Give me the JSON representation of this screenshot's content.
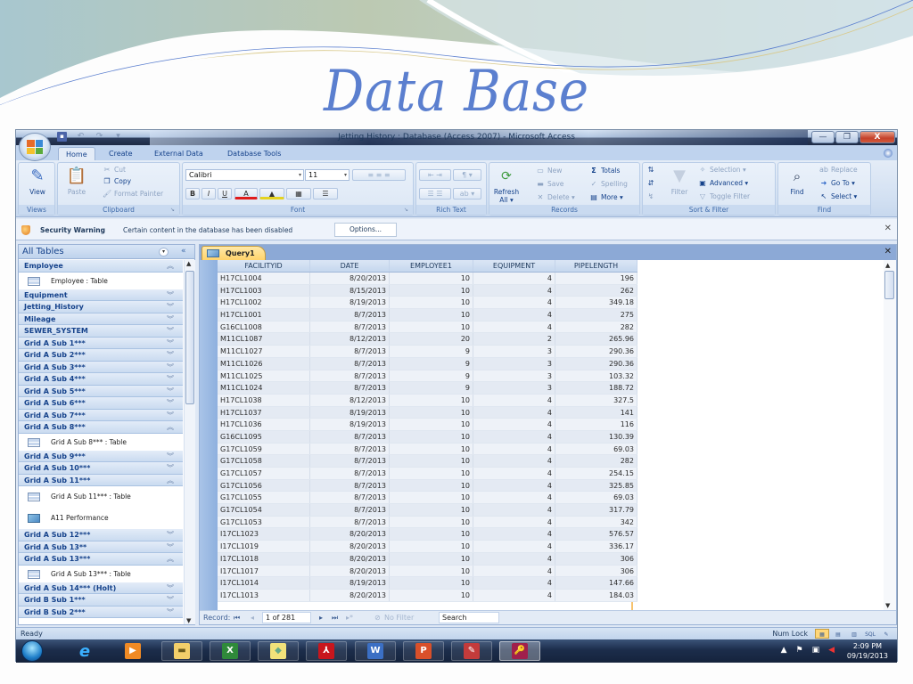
{
  "slide": {
    "title": "Data Base"
  },
  "window": {
    "title": "Jetting History : Database (Access 2007) - Microsoft Access",
    "minimize": "—",
    "maximize": "❐",
    "close": "X"
  },
  "ribbon": {
    "tabs": [
      "Home",
      "Create",
      "External Data",
      "Database Tools"
    ],
    "active_tab": "Home",
    "groups": {
      "views": {
        "label": "Views",
        "view": "View"
      },
      "clipboard": {
        "label": "Clipboard",
        "paste": "Paste",
        "cut": "Cut",
        "copy": "Copy",
        "format_painter": "Format Painter"
      },
      "font": {
        "label": "Font",
        "font_name": "Calibri",
        "font_size": "11",
        "bold": "B",
        "italic": "I",
        "underline": "U",
        "font_color": "A"
      },
      "rich_text": {
        "label": "Rich Text"
      },
      "records": {
        "label": "Records",
        "refresh": "Refresh",
        "refresh_all": "All ▾",
        "new": "New",
        "save": "Save",
        "delete": "Delete ▾",
        "totals": "Totals",
        "spelling": "Spelling",
        "more": "More ▾"
      },
      "sort_filter": {
        "label": "Sort & Filter",
        "filter": "Filter",
        "selection": "Selection ▾",
        "advanced": "Advanced ▾",
        "toggle_filter": "Toggle Filter"
      },
      "find": {
        "label": "Find",
        "find": "Find",
        "replace": "Replace",
        "go_to": "Go To ▾",
        "select": "Select ▾"
      }
    }
  },
  "security_bar": {
    "title": "Security Warning",
    "message": "Certain content in the database has been disabled",
    "options_button": "Options..."
  },
  "nav_pane": {
    "title": "All Tables",
    "items": [
      {
        "type": "group",
        "label": "Employee",
        "expanded": true
      },
      {
        "type": "object",
        "label": "Employee : Table",
        "icon": "table"
      },
      {
        "type": "group",
        "label": "Equipment",
        "expanded": false
      },
      {
        "type": "group",
        "label": "Jetting_History",
        "expanded": false
      },
      {
        "type": "group",
        "label": "Mileage",
        "expanded": false
      },
      {
        "type": "group",
        "label": "SEWER_SYSTEM",
        "expanded": false
      },
      {
        "type": "group",
        "label": "Grid A Sub 1***",
        "expanded": false
      },
      {
        "type": "group",
        "label": "Grid A Sub 2***",
        "expanded": false
      },
      {
        "type": "group",
        "label": "Grid A Sub 3***",
        "expanded": false
      },
      {
        "type": "group",
        "label": "Grid A Sub 4***",
        "expanded": false
      },
      {
        "type": "group",
        "label": "Grid A Sub 5***",
        "expanded": false
      },
      {
        "type": "group",
        "label": "Grid A Sub 6***",
        "expanded": false
      },
      {
        "type": "group",
        "label": "Grid A Sub 7***",
        "expanded": false
      },
      {
        "type": "group",
        "label": "Grid A Sub 8***",
        "expanded": true
      },
      {
        "type": "object",
        "label": "Grid A Sub 8*** : Table",
        "icon": "table"
      },
      {
        "type": "group",
        "label": "Grid A Sub 9***",
        "expanded": false
      },
      {
        "type": "group",
        "label": "Grid A Sub 10***",
        "expanded": false
      },
      {
        "type": "group",
        "label": "Grid A Sub 11***",
        "expanded": true
      },
      {
        "type": "object",
        "label": "Grid A Sub 11*** : Table",
        "icon": "table"
      },
      {
        "type": "object",
        "label": "A11 Performance",
        "icon": "query"
      },
      {
        "type": "group",
        "label": "Grid A Sub 12***",
        "expanded": false
      },
      {
        "type": "group",
        "label": "Grid A Sub 13**",
        "expanded": false
      },
      {
        "type": "group",
        "label": "Grid A Sub 13***",
        "expanded": true
      },
      {
        "type": "object",
        "label": "Grid A Sub 13*** : Table",
        "icon": "table"
      },
      {
        "type": "group",
        "label": "Grid A Sub 14*** (Holt)",
        "expanded": false
      },
      {
        "type": "group",
        "label": "Grid B Sub 1***",
        "expanded": false
      },
      {
        "type": "group",
        "label": "Grid B Sub 2***",
        "expanded": false
      }
    ]
  },
  "document": {
    "tab_label": "Query1",
    "columns": [
      "FACILITYID",
      "DATE",
      "EMPLOYEE1",
      "EQUIPMENT",
      "PIPELENGTH"
    ],
    "rows": [
      [
        "H17CL1004",
        "8/20/2013",
        "10",
        "4",
        "196"
      ],
      [
        "H17CL1003",
        "8/15/2013",
        "10",
        "4",
        "262"
      ],
      [
        "H17CL1002",
        "8/19/2013",
        "10",
        "4",
        "349.18"
      ],
      [
        "H17CL1001",
        "8/7/2013",
        "10",
        "4",
        "275"
      ],
      [
        "G16CL1008",
        "8/7/2013",
        "10",
        "4",
        "282"
      ],
      [
        "M11CL1087",
        "8/12/2013",
        "20",
        "2",
        "265.96"
      ],
      [
        "M11CL1027",
        "8/7/2013",
        "9",
        "3",
        "290.36"
      ],
      [
        "M11CL1026",
        "8/7/2013",
        "9",
        "3",
        "290.36"
      ],
      [
        "M11CL1025",
        "8/7/2013",
        "9",
        "3",
        "103.32"
      ],
      [
        "M11CL1024",
        "8/7/2013",
        "9",
        "3",
        "188.72"
      ],
      [
        "H17CL1038",
        "8/12/2013",
        "10",
        "4",
        "327.5"
      ],
      [
        "H17CL1037",
        "8/19/2013",
        "10",
        "4",
        "141"
      ],
      [
        "H17CL1036",
        "8/19/2013",
        "10",
        "4",
        "116"
      ],
      [
        "G16CL1095",
        "8/7/2013",
        "10",
        "4",
        "130.39"
      ],
      [
        "G17CL1059",
        "8/7/2013",
        "10",
        "4",
        "69.03"
      ],
      [
        "G17CL1058",
        "8/7/2013",
        "10",
        "4",
        "282"
      ],
      [
        "G17CL1057",
        "8/7/2013",
        "10",
        "4",
        "254.15"
      ],
      [
        "G17CL1056",
        "8/7/2013",
        "10",
        "4",
        "325.85"
      ],
      [
        "G17CL1055",
        "8/7/2013",
        "10",
        "4",
        "69.03"
      ],
      [
        "G17CL1054",
        "8/7/2013",
        "10",
        "4",
        "317.79"
      ],
      [
        "G17CL1053",
        "8/7/2013",
        "10",
        "4",
        "342"
      ],
      [
        "I17CL1023",
        "8/20/2013",
        "10",
        "4",
        "576.57"
      ],
      [
        "I17CL1019",
        "8/20/2013",
        "10",
        "4",
        "336.17"
      ],
      [
        "I17CL1018",
        "8/20/2013",
        "10",
        "4",
        "306"
      ],
      [
        "I17CL1017",
        "8/20/2013",
        "10",
        "4",
        "306"
      ],
      [
        "I17CL1014",
        "8/19/2013",
        "10",
        "4",
        "147.66"
      ],
      [
        "I17CL1013",
        "8/20/2013",
        "10",
        "4",
        "184.03"
      ]
    ],
    "record_nav": {
      "label": "Record:",
      "position": "1 of 281",
      "filter": "No Filter",
      "search": "Search"
    }
  },
  "status_bar": {
    "status": "Ready",
    "num_lock": "Num Lock",
    "views": [
      "datasheet",
      "pivot-table",
      "pivot-chart",
      "SQL",
      "design"
    ]
  },
  "taskbar": {
    "apps": [
      "internet-explorer",
      "media-player",
      "file-explorer",
      "excel",
      "sticky-notes",
      "adobe-reader",
      "word",
      "powerpoint",
      "paint",
      "access"
    ],
    "clock_time": "2:09 PM",
    "clock_date": "09/19/2013"
  }
}
